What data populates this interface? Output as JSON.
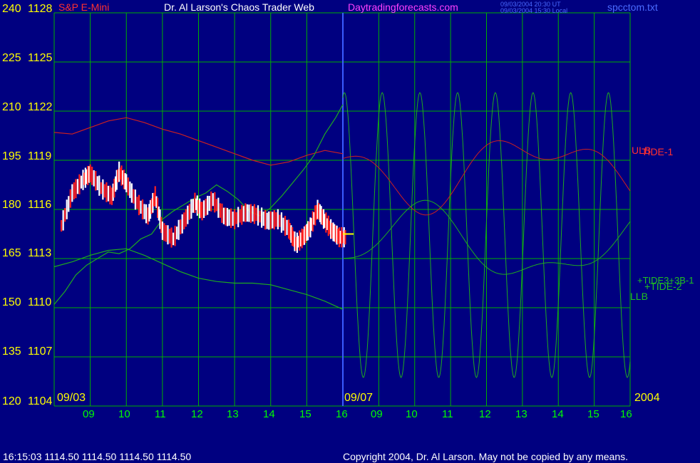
{
  "header": {
    "instrument": "S&P E-Mini",
    "title": "Dr. Al Larson's Chaos Trader Web",
    "site": "Daytradingforecasts.com",
    "ut_time": "09/03/2004 20:30 UT",
    "local_time": "09/03/2004 15:30 Local",
    "file": "spcctom.txt"
  },
  "footer": {
    "quote": "16:15:03  1114.50 1114.50 1114.50 1114.50",
    "copyright": "Copyright 2004, Dr. Al Larson. May not be copied by any means."
  },
  "colors": {
    "background": "#000080",
    "grid": "#00b000",
    "price_up": "#ffffff",
    "price_down": "#ff2020",
    "envelope": "#cc2020",
    "tide": "#1faa1f",
    "axis_text": "#ffff00",
    "date_text": "#00ff00",
    "marker_line": "#3a5cff",
    "site_text": "#ff40ff"
  },
  "chart_data": {
    "type": "line",
    "left_axis_ticks": [
      "240",
      "225",
      "210",
      "195",
      "180",
      "165",
      "150",
      "135",
      "120"
    ],
    "price_axis_ticks": [
      "1128",
      "1125",
      "1122",
      "1119",
      "1116",
      "1113",
      "1110",
      "1107",
      "1104"
    ],
    "ylim": [
      1104,
      1128
    ],
    "x_ticks": [
      "09",
      "10",
      "11",
      "12",
      "13",
      "14",
      "15",
      "16",
      "09",
      "10",
      "11",
      "12",
      "13",
      "14",
      "15",
      "16"
    ],
    "date_labels": {
      "start": "09/03",
      "split": "09/07",
      "year": "2004"
    },
    "series_labels": {
      "upper_band": "ULB",
      "lower_band": "LLB",
      "tide1": "TIDE-1",
      "tide2": "+TIDE-2",
      "tide3": "+TIDE3+3B-1"
    },
    "last_price": 1114.5,
    "x_hours": [
      9,
      10,
      11,
      12,
      13,
      14,
      15,
      16
    ],
    "price_series": {
      "x": [
        8.2,
        8.5,
        8.8,
        9.0,
        9.3,
        9.6,
        9.8,
        10.0,
        10.3,
        10.6,
        10.8,
        11.0,
        11.3,
        11.6,
        11.9,
        12.1,
        12.4,
        12.7,
        13.0,
        13.3,
        13.6,
        13.9,
        14.2,
        14.5,
        14.7,
        14.9,
        15.1,
        15.3,
        15.5,
        15.7,
        15.9
      ],
      "y": [
        1115.0,
        1117.0,
        1117.8,
        1118.2,
        1117.3,
        1116.8,
        1118.3,
        1117.6,
        1116.4,
        1115.6,
        1116.8,
        1114.7,
        1114.2,
        1115.3,
        1116.4,
        1115.9,
        1116.6,
        1115.6,
        1115.4,
        1115.8,
        1115.7,
        1115.3,
        1115.4,
        1114.8,
        1113.9,
        1114.3,
        1114.9,
        1116.0,
        1115.3,
        1114.7,
        1114.3
      ]
    },
    "tide_series": {
      "x": [
        8.0,
        8.3,
        8.6,
        8.9,
        9.2,
        9.5,
        9.8,
        10.1,
        10.4,
        10.7,
        11.0,
        11.3,
        11.6,
        11.9,
        12.2,
        12.5,
        12.8,
        13.1,
        13.4,
        13.7,
        14.0,
        14.3,
        14.6,
        14.9,
        15.2,
        15.5,
        15.8,
        16.0
      ],
      "y": [
        1110.2,
        1111.0,
        1112.0,
        1112.6,
        1113.0,
        1113.4,
        1113.3,
        1113.6,
        1114.2,
        1114.5,
        1115.4,
        1115.9,
        1116.3,
        1116.7,
        1117.0,
        1117.5,
        1117.1,
        1116.6,
        1115.9,
        1115.6,
        1116.1,
        1116.8,
        1117.6,
        1118.4,
        1119.3,
        1120.6,
        1121.6,
        1122.4
      ]
    },
    "envelope_top": {
      "x": [
        8.0,
        8.5,
        9.0,
        9.5,
        10.0,
        10.5,
        11.0,
        11.5,
        12.0,
        12.5,
        13.0,
        13.5,
        14.0,
        14.5,
        15.0,
        15.5,
        16.0
      ],
      "y": [
        1120.7,
        1120.6,
        1121.0,
        1121.4,
        1121.6,
        1121.3,
        1120.9,
        1120.6,
        1120.2,
        1119.8,
        1119.4,
        1119.0,
        1118.7,
        1118.9,
        1119.3,
        1119.6,
        1119.4
      ]
    },
    "envelope_bottom": {
      "x": [
        8.0,
        8.5,
        9.0,
        9.5,
        10.0,
        10.5,
        11.0,
        11.5,
        12.0,
        12.5,
        13.0,
        13.5,
        14.0,
        14.5,
        15.0,
        15.5,
        16.0
      ],
      "y": [
        1112.5,
        1112.8,
        1113.2,
        1113.5,
        1113.6,
        1113.2,
        1112.7,
        1112.2,
        1111.8,
        1111.6,
        1111.5,
        1111.5,
        1111.4,
        1111.1,
        1110.8,
        1110.4,
        1109.9
      ]
    }
  }
}
